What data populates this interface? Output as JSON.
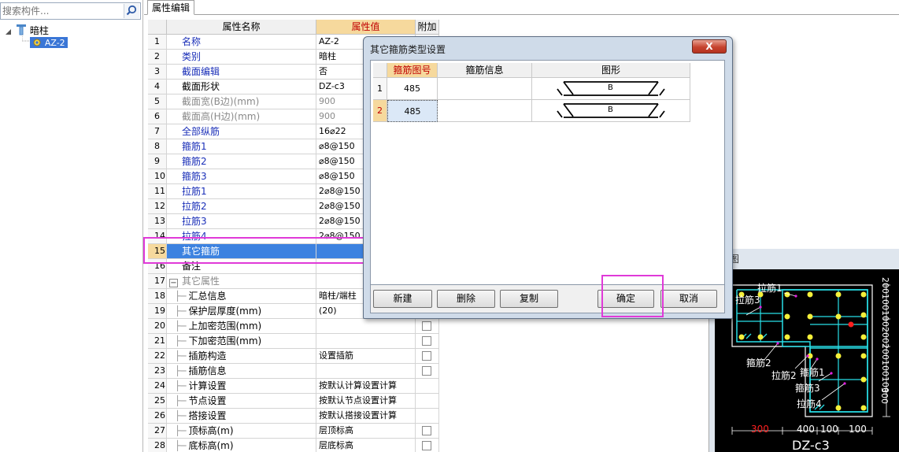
{
  "search": {
    "placeholder": "搜索构件..."
  },
  "tree": {
    "root_label": "暗柱",
    "child_label": "AZ-2"
  },
  "tab": {
    "label": "属性编辑"
  },
  "grid": {
    "headers": {
      "name": "属性名称",
      "value": "属性值",
      "add": "附加"
    },
    "rows": [
      {
        "num": "1",
        "name": "名称",
        "value": "AZ-2"
      },
      {
        "num": "2",
        "name": "类别",
        "value": "暗柱"
      },
      {
        "num": "3",
        "name": "截面编辑",
        "value": "否"
      },
      {
        "num": "4",
        "name": "截面形状",
        "value": "DZ-c3"
      },
      {
        "num": "5",
        "name": "截面宽(B边)(mm)",
        "value": "900"
      },
      {
        "num": "6",
        "name": "截面高(H边)(mm)",
        "value": "900"
      },
      {
        "num": "7",
        "name": "全部纵筋",
        "value": "16⌀22"
      },
      {
        "num": "8",
        "name": "箍筋1",
        "value": "⌀8@150"
      },
      {
        "num": "9",
        "name": "箍筋2",
        "value": "⌀8@150"
      },
      {
        "num": "10",
        "name": "箍筋3",
        "value": "⌀8@150"
      },
      {
        "num": "11",
        "name": "拉筋1",
        "value": "2⌀8@150"
      },
      {
        "num": "12",
        "name": "拉筋2",
        "value": "2⌀8@150"
      },
      {
        "num": "13",
        "name": "拉筋3",
        "value": "2⌀8@150"
      },
      {
        "num": "14",
        "name": "拉筋4",
        "value": "2⌀8@150"
      },
      {
        "num": "15",
        "name": "其它箍筋",
        "value": ""
      },
      {
        "num": "16",
        "name": "备注",
        "value": ""
      },
      {
        "num": "17",
        "name": "其它属性",
        "value": ""
      },
      {
        "num": "18",
        "name": "汇总信息",
        "value": "暗柱/端柱"
      },
      {
        "num": "19",
        "name": "保护层厚度(mm)",
        "value": "(20)"
      },
      {
        "num": "20",
        "name": "上加密范围(mm)",
        "value": ""
      },
      {
        "num": "21",
        "name": "下加密范围(mm)",
        "value": ""
      },
      {
        "num": "22",
        "name": "插筋构造",
        "value": "设置插筋"
      },
      {
        "num": "23",
        "name": "插筋信息",
        "value": ""
      },
      {
        "num": "24",
        "name": "计算设置",
        "value": "按默认计算设置计算"
      },
      {
        "num": "25",
        "name": "节点设置",
        "value": "按默认节点设置计算"
      },
      {
        "num": "26",
        "name": "搭接设置",
        "value": "按默认搭接设置计算"
      },
      {
        "num": "27",
        "name": "顶标高(m)",
        "value": "层顶标高"
      },
      {
        "num": "28",
        "name": "底标高(m)",
        "value": "层底标高"
      }
    ]
  },
  "dialog": {
    "title": "其它箍筋类型设置",
    "close_label": "X",
    "headers": {
      "shape_no": "箍筋图号",
      "info": "箍筋信息",
      "figure": "图形"
    },
    "rows": [
      {
        "num": "1",
        "shape_no": "485",
        "info": "",
        "figure_label": "B"
      },
      {
        "num": "2",
        "shape_no": "485",
        "info": "",
        "figure_label": "B"
      }
    ],
    "buttons": {
      "new": "新建",
      "delete": "删除",
      "copy": "复制",
      "ok": "确定",
      "cancel": "取消"
    }
  },
  "drawing": {
    "panel_title": "图",
    "labels": {
      "tie1_top": "拉筋1",
      "tie3": "拉筋3",
      "hoop2": "箍筋2",
      "tie2": "拉筋2",
      "hoop1": "箍筋1",
      "hoop3": "箍筋3",
      "tie4": "拉筋4",
      "section": "DZ-c3"
    },
    "dims_bottom": [
      "300",
      "400",
      "100",
      "100"
    ],
    "dims_right_top": [
      "200",
      "100",
      "100",
      "200"
    ],
    "dims_right_low": [
      "200",
      "100",
      "100"
    ],
    "dim_right_bottom": "300"
  },
  "colors": {
    "highlight_box": "#e03ad8",
    "selection": "#3c82e0",
    "value_header": "#f6d99d"
  }
}
